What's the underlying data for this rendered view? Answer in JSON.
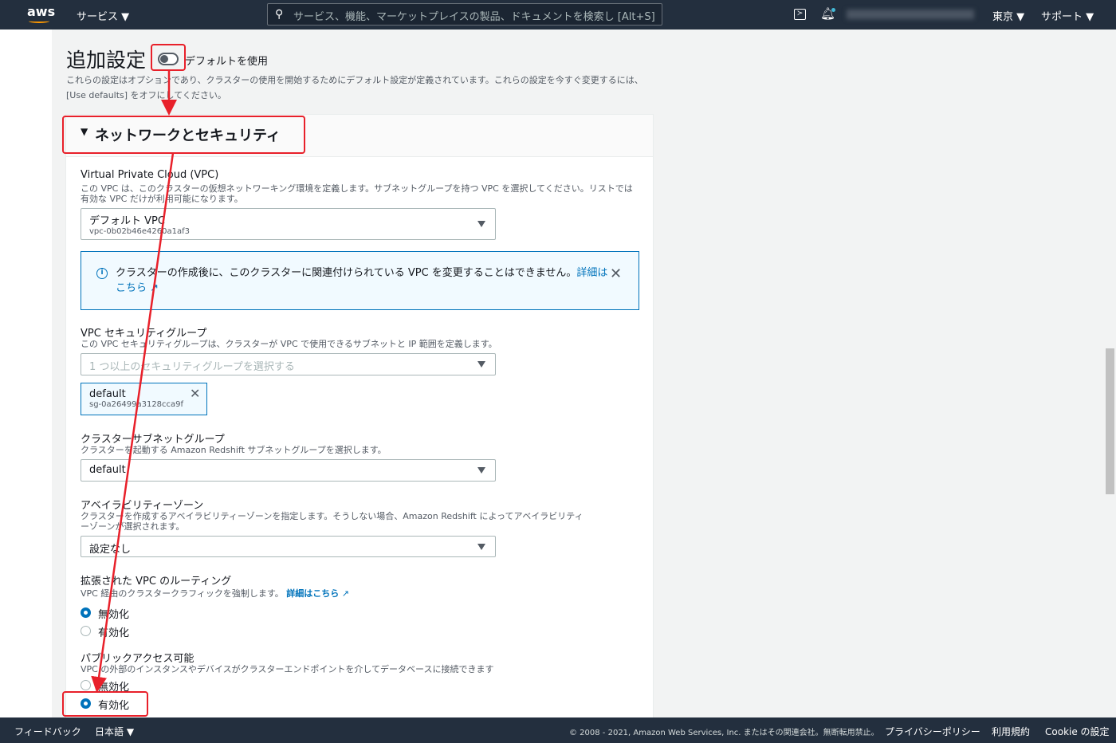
{
  "header": {
    "logo": "aws",
    "services": "サービス",
    "search_placeholder": "サービス、機能、マーケットプレイスの製品、ドキュメントを検索し",
    "search_shortcut": "[Alt+S]",
    "region": "東京",
    "support": "サポート"
  },
  "section": {
    "title": "追加設定",
    "toggle_label": "デフォルトを使用",
    "description_1": "これらの設定はオプションであり、クラスターの使用を開始するためにデフォルト設定が定義されています。これらの設定を今すぐ変更するには、",
    "description_2": "[Use defaults] をオフにしてください。"
  },
  "panel": {
    "title": "ネットワークとセキュリティ",
    "vpc": {
      "label": "Virtual Private Cloud (VPC)",
      "desc_1": "この VPC は、このクラスターの仮想ネットワーキング環境を定義します。サブネットグループを持つ VPC を選択してください。リストでは",
      "desc_2": "有効な VPC だけが利用可能になります。",
      "value": "デフォルト VPC",
      "value_sub": "vpc-0b02b46e4260a1af3"
    },
    "info": {
      "text": "クラスターの作成後に、このクラスターに関連付けられている VPC を変更することはできません。",
      "link_1": "詳細は",
      "link_2": "こちら"
    },
    "sg": {
      "label": "VPC セキュリティグループ",
      "desc": "この VPC セキュリティグループは、クラスターが VPC で使用できるサブネットと IP 範囲を定義します。",
      "placeholder": "1 つ以上のセキュリティグループを選択する",
      "token": "default",
      "token_sub": "sg-0a26499a3128cca9f"
    },
    "subnet": {
      "label": "クラスターサブネットグループ",
      "desc": "クラスターを起動する Amazon Redshift サブネットグループを選択します。",
      "value": "default"
    },
    "az": {
      "label": "アベイラビリティーゾーン",
      "desc_1": "クラスターを作成するアベイラビリティーゾーンを指定します。そうしない場合、Amazon Redshift によってアベイラビリティ",
      "desc_2": "ーゾーンが選択されます。",
      "value": "設定なし"
    },
    "routing": {
      "label": "拡張された VPC のルーティング",
      "desc": "VPC 経由のクラスタークラフィックを強制します。",
      "link": "詳細はこちら",
      "options": [
        "無効化",
        "有効化"
      ],
      "selected": 0
    },
    "public": {
      "label": "パブリックアクセス可能",
      "desc": "VPC の外部のインスタンスやデバイスがクラスターエンドポイントを介してデータベースに接続できます",
      "options": [
        "無効化",
        "有効化"
      ],
      "selected": 1
    }
  },
  "footer": {
    "feedback": "フィードバック",
    "language": "日本語",
    "copyright": "© 2008 - 2021, Amazon Web Services, Inc. またはその関連会社。無断転用禁止。",
    "privacy": "プライバシーポリシー",
    "terms": "利用規約",
    "cookie": "Cookie の設定"
  },
  "colors": {
    "annotation": "#e8202a",
    "accent": "#0073bb",
    "nav": "#232f3e"
  }
}
